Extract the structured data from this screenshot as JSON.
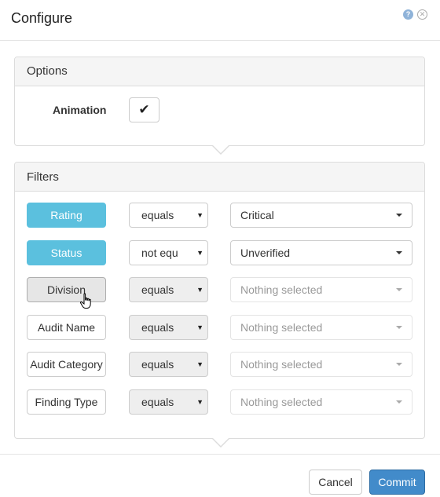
{
  "dialog": {
    "title": "Configure"
  },
  "options": {
    "heading": "Options",
    "animation_label": "Animation",
    "animation_checked": true,
    "check_glyph": "✔"
  },
  "filters": {
    "heading": "Filters",
    "rows": [
      {
        "field": "Rating",
        "state": "active",
        "operator": "equals",
        "operator_enabled": true,
        "value": "Critical",
        "value_enabled": true
      },
      {
        "field": "Status",
        "state": "active",
        "operator": "not equ",
        "operator_enabled": true,
        "value": "Unverified",
        "value_enabled": true
      },
      {
        "field": "Division",
        "state": "hover",
        "operator": "equals",
        "operator_enabled": false,
        "value": "Nothing selected",
        "value_enabled": false
      },
      {
        "field": "Audit Name",
        "state": "plain",
        "operator": "equals",
        "operator_enabled": false,
        "value": "Nothing selected",
        "value_enabled": false
      },
      {
        "field": "Audit Category",
        "state": "plain",
        "operator": "equals",
        "operator_enabled": false,
        "value": "Nothing selected",
        "value_enabled": false
      },
      {
        "field": "Finding Type",
        "state": "plain",
        "operator": "equals",
        "operator_enabled": false,
        "value": "Nothing selected",
        "value_enabled": false
      }
    ]
  },
  "footer": {
    "cancel_label": "Cancel",
    "commit_label": "Commit"
  },
  "colors": {
    "active_field": "#5bc0de",
    "primary": "#428bca"
  },
  "icons": {
    "help": "help-icon",
    "close": "close-icon",
    "cursor": "hand-cursor-icon"
  }
}
